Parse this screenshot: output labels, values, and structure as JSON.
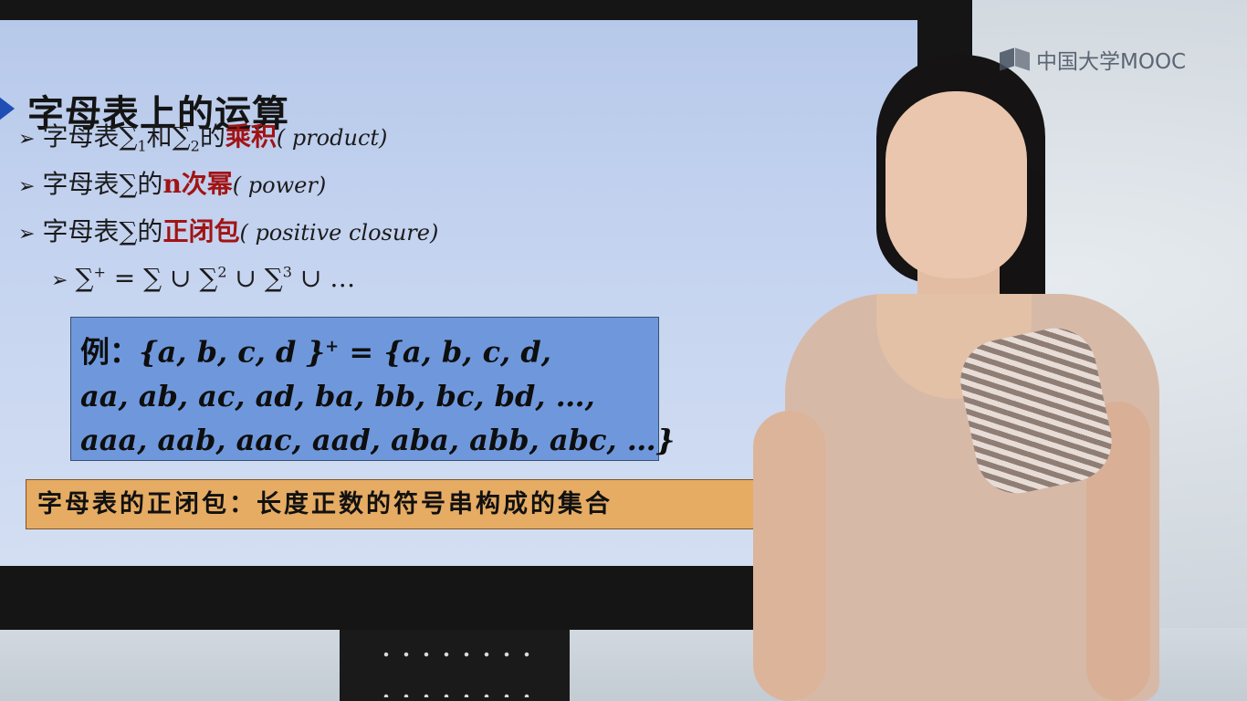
{
  "slide": {
    "title": "字母表上的运算",
    "bullets": [
      {
        "prefix": "字母表∑",
        "sub1": "1",
        "mid": "和∑",
        "sub2": "2",
        "suffix": "的",
        "highlight": "乘积",
        "english": "( product)"
      },
      {
        "prefix": "字母表∑的",
        "highlight": "n次幂",
        "english": "( power)"
      },
      {
        "prefix": "字母表∑的",
        "highlight": "正闭包",
        "english": "( positive closure)"
      }
    ],
    "formula": {
      "lhs": "∑",
      "lhs_sup": "+",
      "rhs_1": " = ∑ ∪ ∑",
      "sup_2": "2",
      "rhs_2": " ∪ ∑",
      "sup_3": "3",
      "rhs_3": " ∪ …"
    },
    "example": {
      "label": "例：",
      "line1_a": "{a, b, c, d }",
      "line1_sup": "+",
      "line1_b": " = {a, b, c, d,",
      "line2": "aa, ab, ac, ad, ba, bb, bc, bd, …,",
      "line3": "aaa, aab, aac, aad, aba, abb, abc, …}"
    },
    "summary": "字母表的正闭包：长度正数的符号串构成的集合"
  },
  "watermark": {
    "logo_icon": "mooc-book-icon",
    "text": "中国大学MOOC"
  },
  "colors": {
    "title_marker": "#1f4fb5",
    "highlight": "#a11414",
    "example_box": "#6f98dc",
    "summary_box": "#e6ac63"
  }
}
